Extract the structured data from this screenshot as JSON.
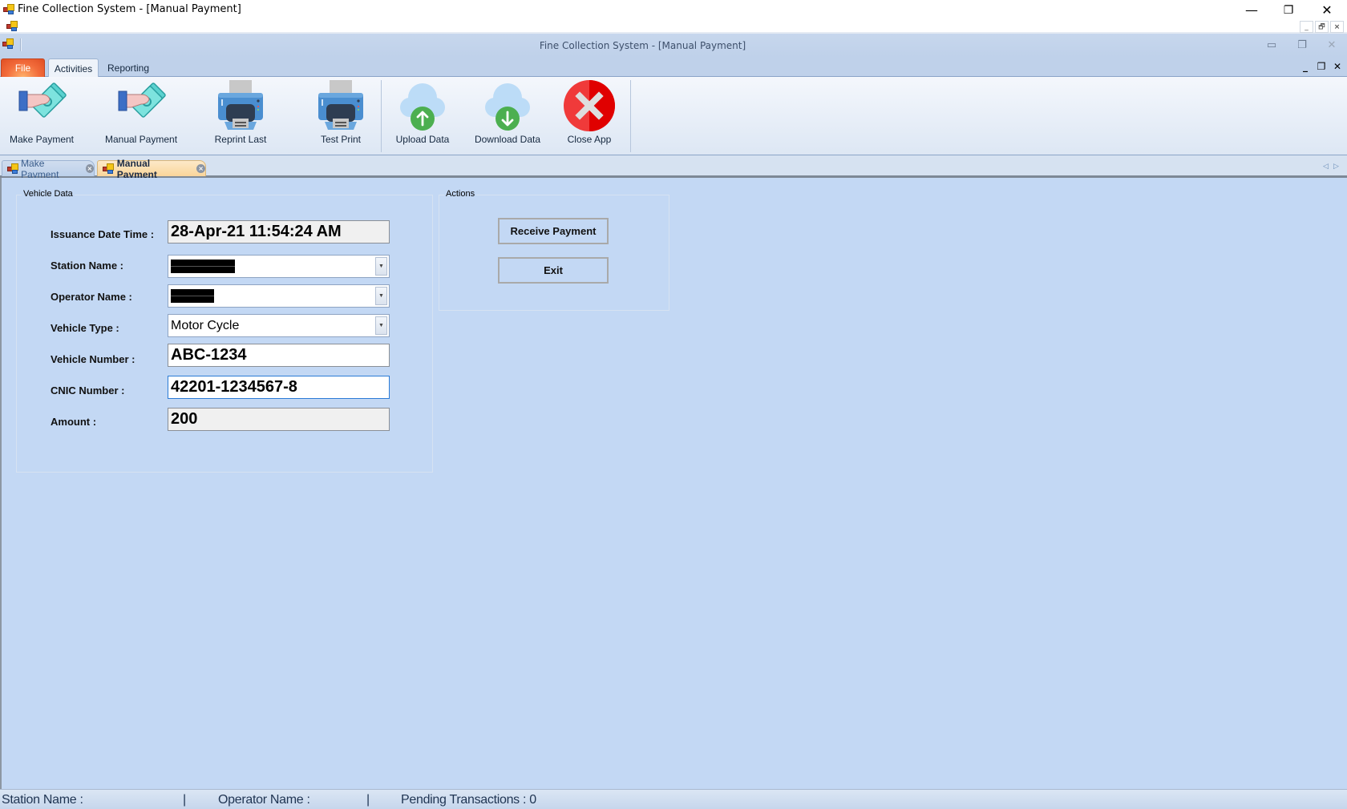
{
  "window": {
    "title": "Fine Collection System - [Manual Payment]",
    "controls": {
      "minimize": "—",
      "restore": "❐",
      "close": "✕"
    },
    "mdi_controls": {
      "minimize": "_",
      "restore": "🗗",
      "close": "×"
    }
  },
  "ribbon": {
    "caption": "Fine Collection System - [Manual Payment]",
    "caption_controls": {
      "minimize": "▭",
      "restore": "❐",
      "close": "✕"
    },
    "child_controls": {
      "minimize": "_",
      "restore": "❐",
      "close": "✕"
    },
    "tabs": [
      {
        "label": "File"
      },
      {
        "label": "Activities"
      },
      {
        "label": "Reporting"
      }
    ],
    "active_tab": "Activities",
    "buttons": [
      {
        "label": "Make Payment",
        "icon": "hand-money-icon"
      },
      {
        "label": "Manual Payment",
        "icon": "hand-money-icon"
      },
      {
        "label": "Reprint Last",
        "icon": "printer-icon"
      },
      {
        "label": "Test Print",
        "icon": "printer-icon"
      },
      {
        "label": "Upload Data",
        "icon": "cloud-upload-icon"
      },
      {
        "label": "Download Data",
        "icon": "cloud-download-icon"
      },
      {
        "label": "Close App",
        "icon": "close-circle-icon"
      }
    ]
  },
  "doc_tabs": [
    {
      "label": "Make Payment",
      "active": false
    },
    {
      "label": "Manual Payment",
      "active": true
    }
  ],
  "doc_nav": {
    "prev": "◁",
    "next": "▷"
  },
  "vehicle_data": {
    "title": "Vehicle Data",
    "fields": {
      "issuance_date_time": {
        "label": "Issuance Date Time :",
        "value": "28-Apr-21 11:54:24 AM"
      },
      "station_name": {
        "label": "Station Name :",
        "value": "[redacted]"
      },
      "operator_name": {
        "label": "Operator Name :",
        "value": "[redacted]"
      },
      "vehicle_type": {
        "label": "Vehicle Type :",
        "value": "Motor Cycle"
      },
      "vehicle_number": {
        "label": "Vehicle Number :",
        "value": "ABC-1234"
      },
      "cnic_number": {
        "label": "CNIC Number :",
        "value": "42201-1234567-8"
      },
      "amount": {
        "label": "Amount :",
        "value": "200"
      }
    }
  },
  "actions": {
    "title": "Actions",
    "receive_payment": "Receive Payment",
    "exit": "Exit"
  },
  "status_bar": {
    "station": "Station Name :",
    "sep": "|",
    "operator": "Operator Name :",
    "pending": "Pending Transactions : 0"
  },
  "colors": {
    "client_bg": "#c3d8f4",
    "ribbon_bg": "#bfd1ea",
    "file_tab": "#f26b3a",
    "active_doc_tab": "#f9d59a",
    "focus_border": "#2b7bd6"
  }
}
